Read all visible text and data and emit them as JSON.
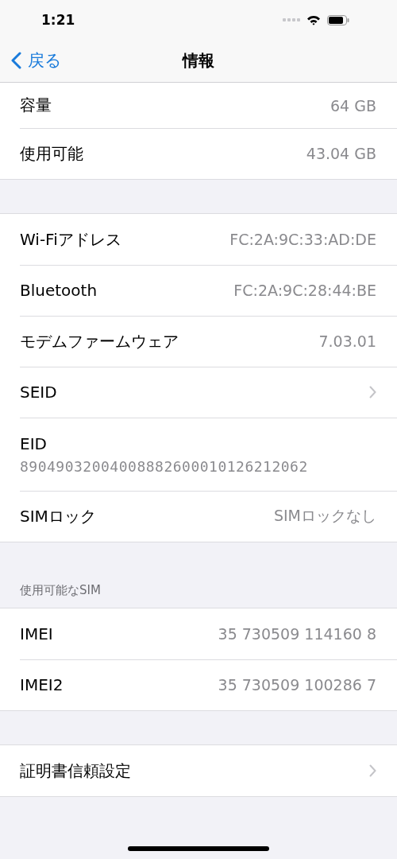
{
  "status_bar": {
    "time": "1:21"
  },
  "nav": {
    "back": "戻る",
    "title": "情報"
  },
  "sections": [
    {
      "rows": [
        {
          "kind": "value",
          "label": "容量",
          "value": "64 GB"
        },
        {
          "kind": "value",
          "label": "使用可能",
          "value": "43.04 GB"
        }
      ]
    },
    {
      "rows": [
        {
          "kind": "value",
          "label": "Wi-Fiアドレス",
          "value": "FC:2A:9C:33:AD:DE"
        },
        {
          "kind": "value",
          "label": "Bluetooth",
          "value": "FC:2A:9C:28:44:BE"
        },
        {
          "kind": "value",
          "label": "モデムファームウェア",
          "value": "7.03.01"
        },
        {
          "kind": "chevron",
          "label": "SEID"
        },
        {
          "kind": "stacked",
          "label": "EID",
          "value": "89049032004008882600010126212062"
        },
        {
          "kind": "value",
          "label": "SIMロック",
          "value": "SIMロックなし"
        }
      ]
    },
    {
      "header": "使用可能なSIM",
      "rows": [
        {
          "kind": "value",
          "label": "IMEI",
          "value": "35 730509 114160 8"
        },
        {
          "kind": "value",
          "label": "IMEI2",
          "value": "35 730509 100286 7"
        }
      ]
    },
    {
      "rows": [
        {
          "kind": "chevron",
          "label": "証明書信頼設定"
        }
      ]
    }
  ]
}
